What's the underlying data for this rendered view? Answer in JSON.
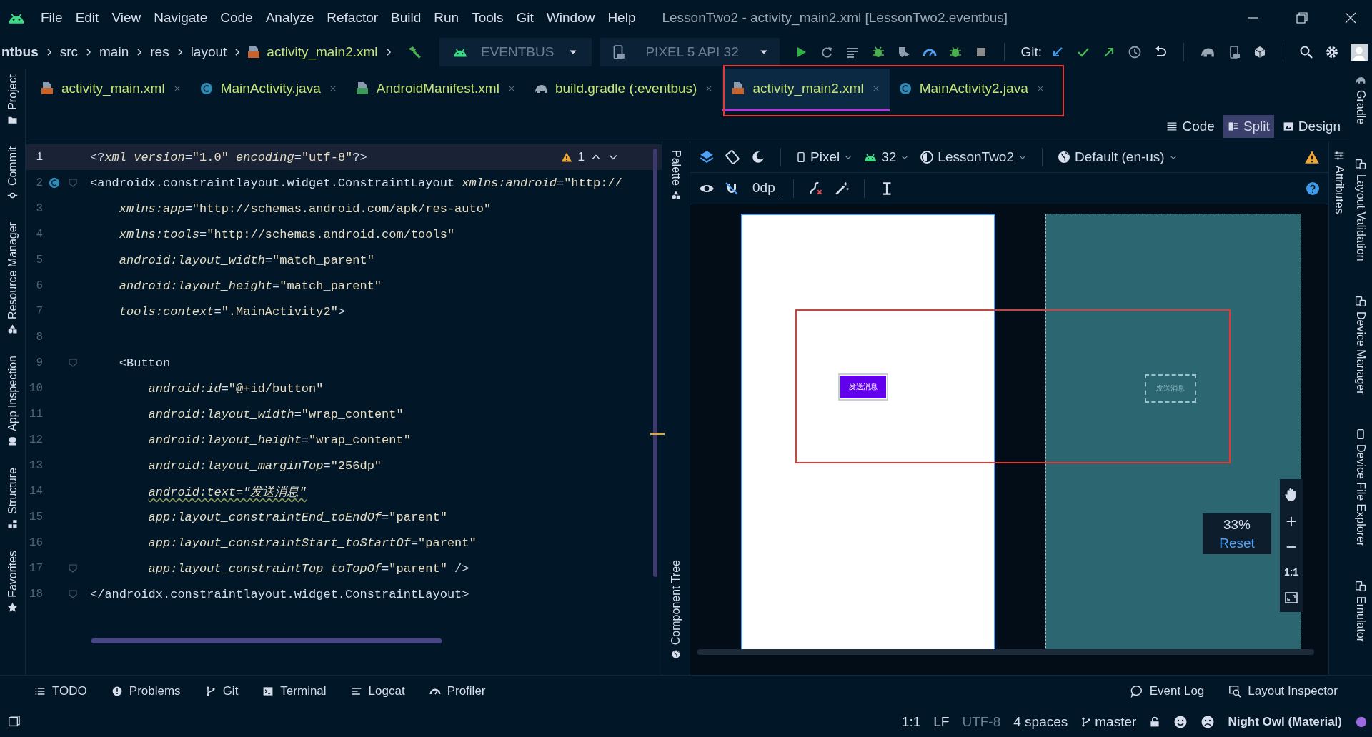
{
  "window": {
    "title": "LessonTwo2 - activity_main2.xml [LessonTwo2.eventbus]"
  },
  "menu": [
    "File",
    "Edit",
    "View",
    "Navigate",
    "Code",
    "Analyze",
    "Refactor",
    "Build",
    "Run",
    "Tools",
    "Git",
    "Window",
    "Help"
  ],
  "breadcrumbs": [
    {
      "label": "ntbus",
      "kind": "module"
    },
    {
      "label": "src",
      "kind": "folder"
    },
    {
      "label": "main",
      "kind": "folder"
    },
    {
      "label": "res",
      "kind": "folder"
    },
    {
      "label": "layout",
      "kind": "folder"
    },
    {
      "label": "activity_main2.xml",
      "kind": "file"
    }
  ],
  "run_config": "EVENTBUS",
  "device": "PIXEL 5 API 32",
  "git_label": "Git:",
  "tabs": [
    {
      "label": "activity_main.xml",
      "kind": "xml",
      "selected": false
    },
    {
      "label": "MainActivity.java",
      "kind": "java",
      "selected": false
    },
    {
      "label": "AndroidManifest.xml",
      "kind": "manifest",
      "selected": false
    },
    {
      "label": "build.gradle (:eventbus)",
      "kind": "gradle",
      "selected": false
    },
    {
      "label": "activity_main2.xml",
      "kind": "xml",
      "selected": true
    },
    {
      "label": "MainActivity2.java",
      "kind": "java",
      "selected": false
    }
  ],
  "view_modes": [
    {
      "label": "Code",
      "selected": false
    },
    {
      "label": "Split",
      "selected": true
    },
    {
      "label": "Design",
      "selected": false
    }
  ],
  "editor": {
    "warning_count": "1",
    "lines": [
      {
        "number": "1",
        "selected": true,
        "class_icon": false,
        "fold": false,
        "tokens": [
          {
            "kind": "punct",
            "text": "<?"
          },
          {
            "kind": "attr",
            "text": "xml version"
          },
          {
            "kind": "punct",
            "text": "="
          },
          {
            "kind": "string",
            "text": "\"1.0\""
          },
          {
            "kind": "attr",
            "text": " encoding"
          },
          {
            "kind": "punct",
            "text": "="
          },
          {
            "kind": "string",
            "text": "\"utf-8\""
          },
          {
            "kind": "punct",
            "text": "?>"
          }
        ]
      },
      {
        "number": "2",
        "selected": false,
        "class_icon": true,
        "fold": true,
        "tokens": [
          {
            "kind": "tag",
            "text": "<androidx.constraintlayout.widget.ConstraintLayout"
          },
          {
            "kind": "attr",
            "text": " xmlns:android"
          },
          {
            "kind": "punct",
            "text": "="
          },
          {
            "kind": "string",
            "text": "\"http://"
          }
        ]
      },
      {
        "number": "3",
        "selected": false,
        "tokens": [
          {
            "kind": "attr",
            "text": "    xmlns:app"
          },
          {
            "kind": "punct",
            "text": "="
          },
          {
            "kind": "string",
            "text": "\"http://schemas.android.com/apk/res-auto\""
          }
        ]
      },
      {
        "number": "4",
        "selected": false,
        "tokens": [
          {
            "kind": "attr",
            "text": "    xmlns:tools"
          },
          {
            "kind": "punct",
            "text": "="
          },
          {
            "kind": "string",
            "text": "\"http://schemas.android.com/tools\""
          }
        ]
      },
      {
        "number": "5",
        "selected": false,
        "tokens": [
          {
            "kind": "attr",
            "text": "    android:layout_width"
          },
          {
            "kind": "punct",
            "text": "="
          },
          {
            "kind": "string",
            "text": "\"match_parent\""
          }
        ]
      },
      {
        "number": "6",
        "selected": false,
        "tokens": [
          {
            "kind": "attr",
            "text": "    android:layout_height"
          },
          {
            "kind": "punct",
            "text": "="
          },
          {
            "kind": "string",
            "text": "\"match_parent\""
          }
        ]
      },
      {
        "number": "7",
        "selected": false,
        "tokens": [
          {
            "kind": "attr",
            "text": "    tools:context"
          },
          {
            "kind": "punct",
            "text": "="
          },
          {
            "kind": "string",
            "text": "\".MainActivity2\""
          },
          {
            "kind": "punct",
            "text": ">"
          }
        ]
      },
      {
        "number": "8",
        "selected": false
      },
      {
        "number": "9",
        "selected": false,
        "class_icon": false,
        "fold": true,
        "tokens": [
          {
            "kind": "tag",
            "text": "    <Button"
          }
        ]
      },
      {
        "number": "10",
        "selected": false,
        "tokens": [
          {
            "kind": "attr",
            "text": "        android:id"
          },
          {
            "kind": "punct",
            "text": "="
          },
          {
            "kind": "string",
            "text": "\"@+id/button\""
          }
        ]
      },
      {
        "number": "11",
        "selected": false,
        "tokens": [
          {
            "kind": "attr",
            "text": "        android:layout_width"
          },
          {
            "kind": "punct",
            "text": "="
          },
          {
            "kind": "string",
            "text": "\"wrap_content\""
          }
        ]
      },
      {
        "number": "12",
        "selected": false,
        "tokens": [
          {
            "kind": "attr",
            "text": "        android:layout_height"
          },
          {
            "kind": "punct",
            "text": "="
          },
          {
            "kind": "string",
            "text": "\"wrap_content\""
          }
        ]
      },
      {
        "number": "13",
        "selected": false,
        "tokens": [
          {
            "kind": "attr",
            "text": "        android:layout_marginTop"
          },
          {
            "kind": "punct",
            "text": "="
          },
          {
            "kind": "string",
            "text": "\"256dp\""
          }
        ]
      },
      {
        "number": "14",
        "selected": false,
        "tokens": [
          {
            "kind": "warn",
            "text": "        android:text=\"发送消息\""
          }
        ]
      },
      {
        "number": "15",
        "selected": false,
        "tokens": [
          {
            "kind": "attr",
            "text": "        app:layout_constraintEnd_toEndOf"
          },
          {
            "kind": "punct",
            "text": "="
          },
          {
            "kind": "string",
            "text": "\"parent\""
          }
        ]
      },
      {
        "number": "16",
        "selected": false,
        "tokens": [
          {
            "kind": "attr",
            "text": "        app:layout_constraintStart_toStartOf"
          },
          {
            "kind": "punct",
            "text": "="
          },
          {
            "kind": "string",
            "text": "\"parent\""
          }
        ]
      },
      {
        "number": "17",
        "selected": false,
        "class_icon": false,
        "fold": true,
        "tokens": [
          {
            "kind": "attr",
            "text": "        app:layout_constraintTop_toTopOf"
          },
          {
            "kind": "punct",
            "text": "="
          },
          {
            "kind": "string",
            "text": "\"parent\""
          },
          {
            "kind": "punct",
            "text": " />"
          }
        ]
      },
      {
        "number": "18",
        "selected": false,
        "class_icon": false,
        "fold": true,
        "tokens": [
          {
            "kind": "tag",
            "text": "</androidx.constraintlayout.widget.ConstraintLayout>"
          }
        ]
      }
    ]
  },
  "palette_strip": {
    "top": "Palette",
    "bottom": "Component Tree"
  },
  "design": {
    "device": "Pixel",
    "api": "32",
    "theme": "LessonTwo2",
    "locale": "Default (en-us)",
    "margin": "0dp",
    "preview_button": "发送消息",
    "blueprint_button": "发送消息",
    "zoom": "33%",
    "reset": "Reset",
    "actual_size": "1:1"
  },
  "left_tools": [
    "Project",
    "Commit",
    "Resource Manager",
    "App Inspection",
    "Structure",
    "Favorites"
  ],
  "right_tools": [
    "Gradle",
    "Layout Validation",
    "Device Manager",
    "Device File Explorer",
    "Emulator"
  ],
  "attributes_tab": "Attributes",
  "bottom_tools_left": [
    "TODO",
    "Problems",
    "Git",
    "Terminal",
    "Logcat",
    "Profiler"
  ],
  "bottom_tools_right": [
    "Event Log",
    "Layout Inspector"
  ],
  "status_bar": {
    "position": "1:1",
    "line_separator": "LF",
    "encoding": "UTF-8",
    "indent": "4 spaces",
    "branch": "master",
    "theme": "Night Owl (Material)"
  }
}
